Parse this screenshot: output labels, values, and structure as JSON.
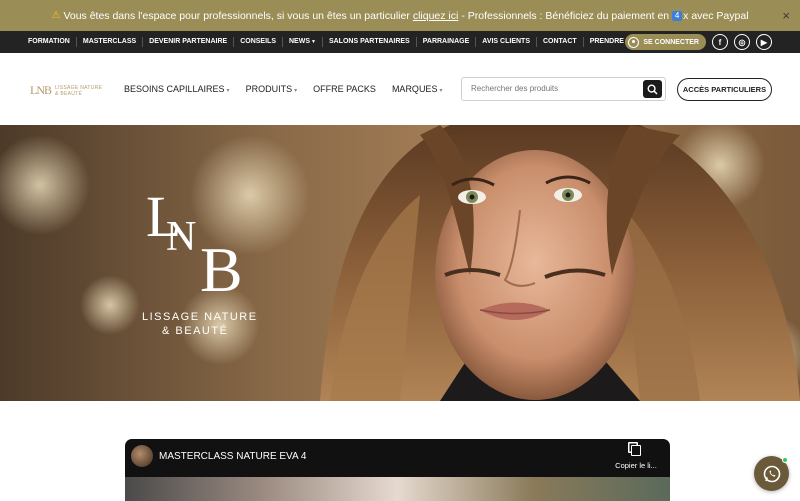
{
  "announcement": {
    "text_before": "Vous êtes dans l'espace pour professionnels, si vous un êtes un particulier",
    "link": "cliquez ici",
    "text_after": "- Professionnels : Bénéficiez du paiement en",
    "installments": "4",
    "text_end": "x avec Paypal",
    "close": "×"
  },
  "topnav": {
    "items": [
      {
        "label": "FORMATION"
      },
      {
        "label": "MASTERCLASS"
      },
      {
        "label": "DEVENIR PARTENAIRE"
      },
      {
        "label": "CONSEILS"
      },
      {
        "label": "NEWS"
      },
      {
        "label": "SALONS PARTENAIRES"
      },
      {
        "label": "PARRAINAGE"
      },
      {
        "label": "AVIS CLIENTS"
      },
      {
        "label": "CONTACT"
      },
      {
        "label": "PRENDRE RDV"
      }
    ],
    "login": "SE CONNECTER",
    "social": [
      "f",
      "◎",
      "▶"
    ]
  },
  "header": {
    "logo_mark": "LNB",
    "logo_text_1": "LISSAGE NATURE",
    "logo_text_2": "& BEAUTÉ",
    "nav": [
      {
        "label": "BESOINS CAPILLAIRES"
      },
      {
        "label": "PRODUITS"
      },
      {
        "label": "OFFRE PACKS"
      },
      {
        "label": "MARQUES"
      }
    ],
    "search_placeholder": "Rechercher des produits",
    "particuliers_button": "ACCÈS PARTICULIERS"
  },
  "hero": {
    "mark_l": "L",
    "mark_n": "N",
    "mark_b": "B",
    "tagline_1": "LISSAGE NATURE",
    "tagline_2": "& BEAUTÉ"
  },
  "video": {
    "title": "MASTERCLASS NATURE EVA 4",
    "copy_label": "Copier le li..."
  },
  "colors": {
    "gold": "#9b8d56",
    "dark": "#232323",
    "whatsapp_bg": "#6b5a3a"
  }
}
